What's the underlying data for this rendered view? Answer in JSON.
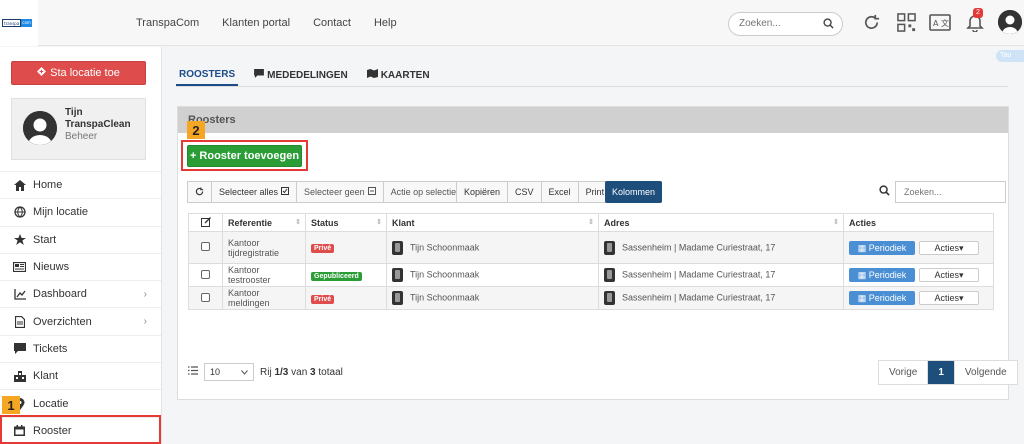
{
  "topbar": {
    "logo": {
      "part1": "transpa",
      "part2": "com"
    },
    "nav": [
      "TranspaCom",
      "Klanten portal",
      "Contact",
      "Help"
    ],
    "search_placeholder": "Zoeken...",
    "notification_count": "2",
    "side_tab": "Tau"
  },
  "sidebar": {
    "add_location_label": "Sta locatie toe",
    "user": {
      "first": "Tijn",
      "company": "TranspaClean",
      "role": "Beheer"
    },
    "items": [
      {
        "label": "Home",
        "icon": "home-icon"
      },
      {
        "label": "Mijn locatie",
        "icon": "globe-icon"
      },
      {
        "label": "Start",
        "icon": "star-icon"
      },
      {
        "label": "Nieuws",
        "icon": "newspaper-icon"
      },
      {
        "label": "Dashboard",
        "icon": "chart-icon",
        "has_children": true
      },
      {
        "label": "Overzichten",
        "icon": "document-icon",
        "has_children": true
      },
      {
        "label": "Tickets",
        "icon": "chat-icon"
      },
      {
        "label": "Klant",
        "icon": "building-icon"
      },
      {
        "label": "Locatie",
        "icon": "pin-icon"
      },
      {
        "label": "Rooster",
        "icon": "calendar-icon"
      }
    ],
    "chevron": "›"
  },
  "callouts": {
    "one": "1",
    "two": "2"
  },
  "tabs": [
    "ROOSTERS",
    "MEDEDELINGEN",
    "KAARTEN"
  ],
  "panel": {
    "title": "Roosters",
    "add_button": "+ Rooster toevoegen",
    "toolbar1": [
      "Selecteer alles",
      "Selecteer geen",
      "Actie op selectie"
    ],
    "toolbar2": [
      "Kopiëren",
      "CSV",
      "Excel",
      "Print"
    ],
    "columns_button": "Kolommen",
    "search_placeholder": "Zoeken...",
    "headers": [
      "Referentie",
      "Status",
      "Klant",
      "Adres",
      "Acties"
    ],
    "rows": [
      {
        "ref": "Kantoor tijdregistratie",
        "status": "Privé",
        "status_type": "priv",
        "klant": "Tijn Schoonmaak",
        "adres": "Sassenheim | Madame Curiestraat, 17"
      },
      {
        "ref": "Kantoor testrooster",
        "status": "Gepubliceerd",
        "status_type": "pub",
        "klant": "Tijn Schoonmaak",
        "adres": "Sassenheim | Madame Curiestraat, 17"
      },
      {
        "ref": "Kantoor meldingen",
        "status": "Privé",
        "status_type": "priv",
        "klant": "Tijn Schoonmaak",
        "adres": "Sassenheim | Madame Curiestraat, 17"
      }
    ],
    "periodiek_label": "Periodiek",
    "acties_label": "Acties▾",
    "page_size": "10",
    "summary_prefix": "Rij ",
    "summary_range": "1/3",
    "summary_mid": " van ",
    "summary_total": "3",
    "summary_suffix": " totaal",
    "pager": [
      "Vorige",
      "1",
      "Volgende"
    ]
  },
  "colors": {
    "accent": "#1e4f7c",
    "danger": "#de4c4c",
    "success": "#2a9d36",
    "info": "#4a8fd4",
    "callout": "#f5a623"
  }
}
